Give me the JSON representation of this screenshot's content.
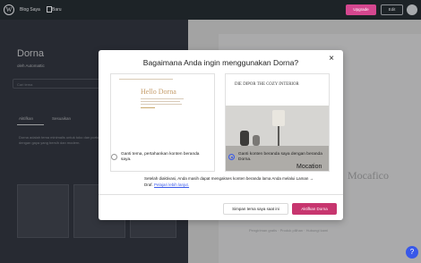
{
  "topbar": {
    "wp_label": "W",
    "site_label": "Blog Saya",
    "new_label": "Baru",
    "upgrade_label": "Upgrade",
    "edit_label": "Edit",
    "accent": "#d4478f"
  },
  "sidebar": {
    "title": "Dorna",
    "subtitle": "oleh Automattic",
    "search_placeholder": "Cari tema",
    "tabs": [
      "Aktifkan",
      "Sesuaikan"
    ],
    "description": "Dorna adalah tema minimalis untuk toko dan portofolio. Tampilkan produk unggulan Anda dengan gaya yang bersih dan modern."
  },
  "preview": {
    "brand": "Mocafico",
    "bottom_text": "Pengiriman gratis  ·  Produk pilihan  ·  Hubungi kami"
  },
  "modal": {
    "title": "Bagaimana Anda ingin menggunakan Dorna?",
    "close_label": "×",
    "card_left_title": "Hello Dorna",
    "card_right_title": "DIE DIPOR THE COZY INTERIOR",
    "card_right_photo_text": "Mocation",
    "option_left": "Ganti tema, pertahankan konten beranda saya.",
    "option_right": "Ganti konten beranda saya dengan beranda Dorna.",
    "note_text": "Setelah diaktivasi, Anda masih dapat mengakses konten beranda lama Anda melalui Laman → Draf.",
    "note_link": "Pelajari lebih lanjut.",
    "keep_button": "Simpan tema saya saat ini",
    "activate_button": "Aktifkan Dorna",
    "accent": "#c7366f"
  },
  "help_label": "?"
}
